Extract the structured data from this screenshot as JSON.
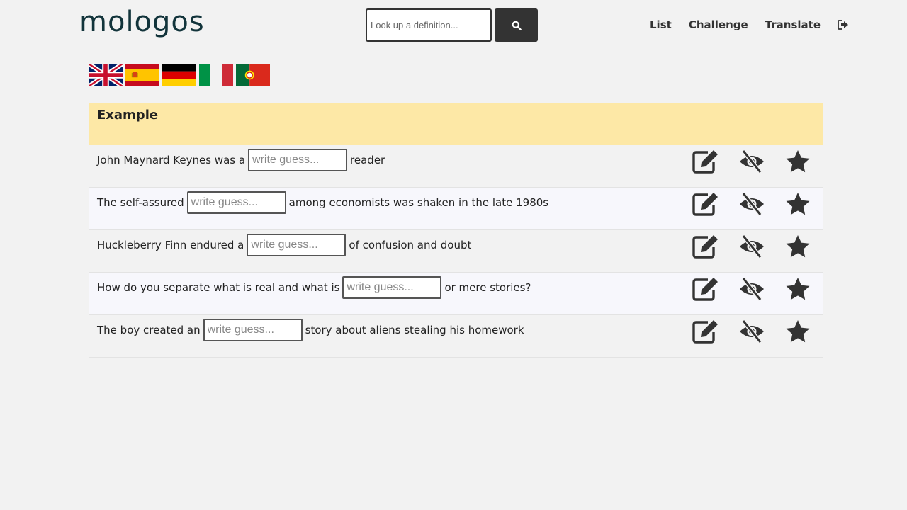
{
  "header": {
    "logo_text": "mologos",
    "search": {
      "placeholder": "Look up a definition...",
      "value": "",
      "button_icon": "search-icon"
    },
    "nav": [
      {
        "label": "List"
      },
      {
        "label": "Challenge"
      },
      {
        "label": "Translate"
      }
    ],
    "logout_icon": "sign-out-icon"
  },
  "flags": [
    {
      "icon": "flag-uk-icon"
    },
    {
      "icon": "flag-spain-icon"
    },
    {
      "icon": "flag-germany-icon"
    },
    {
      "icon": "flag-italy-icon"
    },
    {
      "icon": "flag-portugal-icon"
    }
  ],
  "panel": {
    "title": "Example",
    "input_placeholder": "write guess...",
    "rows": [
      {
        "before": "John Maynard Keynes was a",
        "after": "reader"
      },
      {
        "before": "The self-assured",
        "after": "among economists was shaken in the late 1980s"
      },
      {
        "before": "Huckleberry Finn endured a",
        "after": "of confusion and doubt"
      },
      {
        "before": "How do you separate what is real and what is",
        "after": "or mere stories?"
      },
      {
        "before": "The boy created an",
        "after": "story about aliens stealing his homework"
      }
    ],
    "row_actions": [
      "edit-icon",
      "eye-slash-icon",
      "star-icon"
    ]
  },
  "colors": {
    "accent_dark": "#333333",
    "header_highlight": "#fde8a6",
    "logo": "#12343b"
  }
}
